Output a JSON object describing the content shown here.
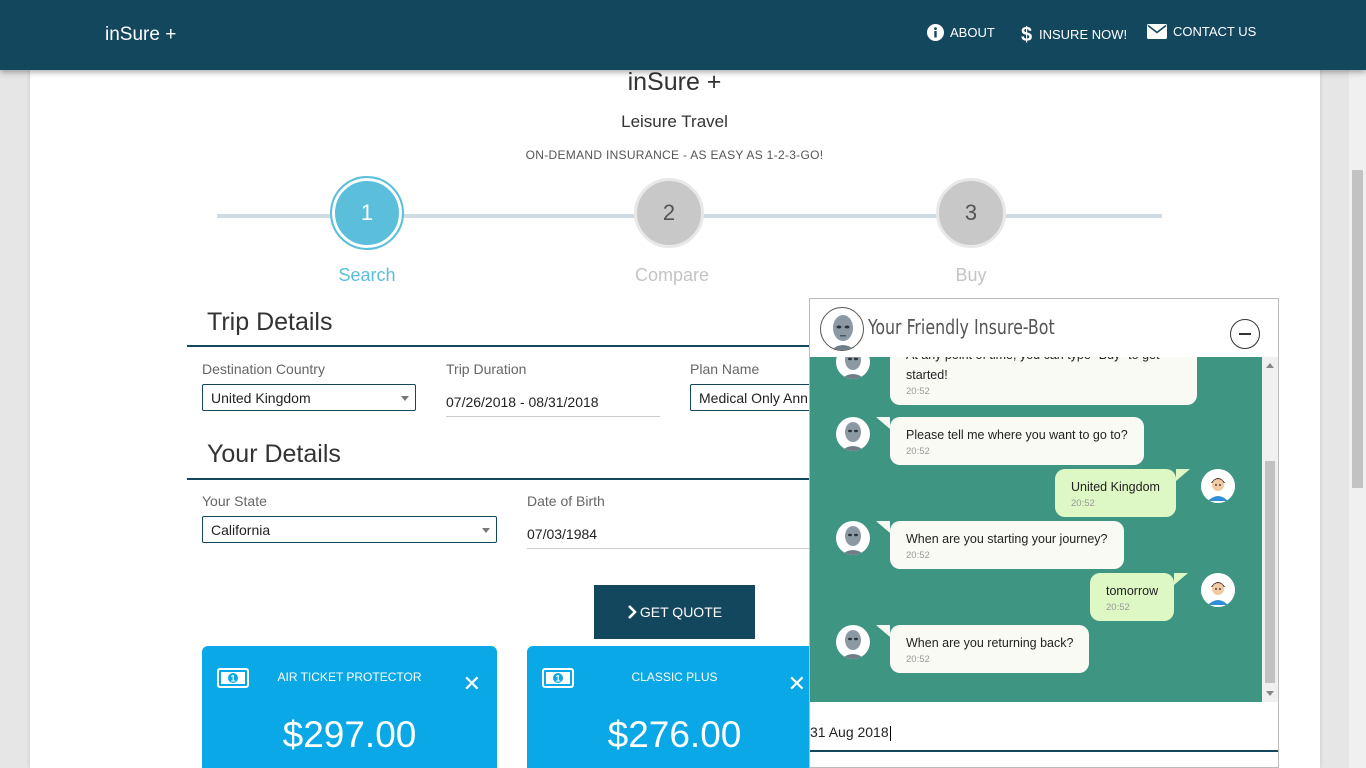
{
  "navbar": {
    "brand": "inSure +",
    "items": [
      {
        "label": "ABOUT",
        "icon": "info-icon"
      },
      {
        "label": "INSURE NOW!",
        "icon": "dollar-icon"
      },
      {
        "label": "CONTACT US",
        "icon": "envelope-icon"
      }
    ]
  },
  "header": {
    "title": "inSure +",
    "subtitle": "Leisure Travel",
    "tagline": "ON-DEMAND INSURANCE - AS EASY AS 1-2-3-GO!"
  },
  "steps": [
    {
      "number": "1",
      "label": "Search",
      "active": true
    },
    {
      "number": "2",
      "label": "Compare",
      "active": false
    },
    {
      "number": "3",
      "label": "Buy",
      "active": false
    }
  ],
  "trip": {
    "title": "Trip Details",
    "destination_label": "Destination Country",
    "destination_value": "United Kingdom",
    "duration_label": "Trip Duration",
    "duration_value": "07/26/2018 - 08/31/2018",
    "plan_label": "Plan Name",
    "plan_value": "Medical Only Ann"
  },
  "details": {
    "title": "Your Details",
    "state_label": "Your State",
    "state_value": "California",
    "dob_label": "Date of Birth",
    "dob_value": "07/03/1984"
  },
  "quote_button": "GET QUOTE",
  "plans": [
    {
      "name": "AIR TICKET PROTECTOR",
      "price": "$297.00"
    },
    {
      "name": "CLASSIC PLUS",
      "price": "$276.00"
    }
  ],
  "chat": {
    "title": "Your Friendly Insure-Bot",
    "messages": [
      {
        "from": "bot",
        "text": "At any point of time, you can type \"Buy\" to get started!",
        "time": "20:52"
      },
      {
        "from": "bot",
        "text": "Please tell me where you want to go to?",
        "time": "20:52"
      },
      {
        "from": "user",
        "text": "United Kingdom",
        "time": "20:52"
      },
      {
        "from": "bot",
        "text": "When are you starting your journey?",
        "time": "20:52"
      },
      {
        "from": "user",
        "text": "tomorrow",
        "time": "20:52"
      },
      {
        "from": "bot",
        "text": "When are you returning back?",
        "time": "20:52"
      }
    ],
    "input_value": "31 Aug 2018"
  },
  "colors": {
    "navbar": "#13475e",
    "step_active": "#5bbfdc",
    "card": "#0aa8e6",
    "chat_bg": "#3d9582"
  }
}
